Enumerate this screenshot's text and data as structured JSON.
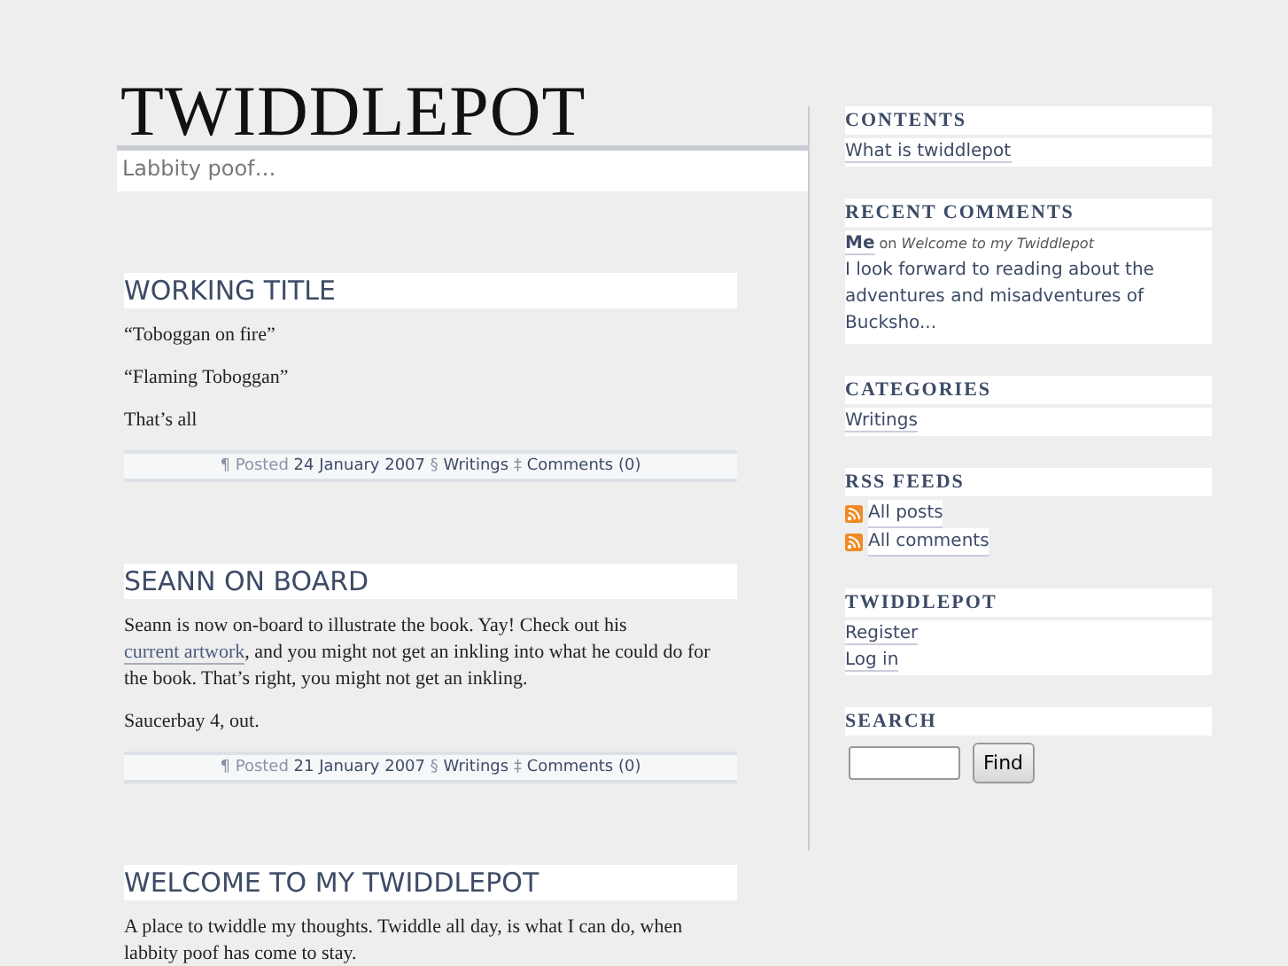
{
  "header": {
    "title": "TWIDDLEPOT",
    "tagline": "Labbity poof…"
  },
  "posts": [
    {
      "title": "WORKING TITLE",
      "paragraphs": [
        [
          {
            "text": "“Toboggan on fire”"
          }
        ],
        [
          {
            "text": "“Flaming Toboggan”"
          }
        ],
        [
          {
            "text": "That’s all"
          }
        ]
      ],
      "meta": {
        "posted": "¶ Posted",
        "date": "24 January 2007",
        "sep1": "§",
        "category": "Writings",
        "sep2": "‡",
        "comments": "Comments (0)"
      }
    },
    {
      "title": "SEANN ON BOARD",
      "paragraphs": [
        [
          {
            "text": "Seann is now on-board to illustrate the book. Yay! Check out his "
          },
          {
            "link": "current artwork"
          },
          {
            "text": ", and you might not get an inkling into what he could do for the book. That’s right, you might not get an inkling."
          }
        ],
        [
          {
            "text": "Saucerbay 4, out."
          }
        ]
      ],
      "meta": {
        "posted": "¶ Posted",
        "date": "21 January 2007",
        "sep1": "§",
        "category": "Writings",
        "sep2": "‡",
        "comments": "Comments (0)"
      }
    },
    {
      "title": "WELCOME TO MY TWIDDLEPOT",
      "paragraphs": [
        [
          {
            "text": "A place to twiddle my thoughts. Twiddle all day, is what I can do, when labbity poof has come to stay."
          }
        ]
      ]
    }
  ],
  "sidebar": [
    {
      "kind": "links",
      "title": "CONTENTS",
      "items": [
        "What is twiddlepot"
      ]
    },
    {
      "kind": "comments",
      "title": "RECENT COMMENTS",
      "author": "Me",
      "on": "on",
      "post": "Welcome to my Twiddlepot",
      "excerpt": "I look forward to reading about the adventures and misadventures of Bucksho..."
    },
    {
      "kind": "links",
      "title": "CATEGORIES",
      "items": [
        "Writings"
      ]
    },
    {
      "kind": "feeds",
      "title": "RSS FEEDS",
      "items": [
        "All posts",
        "All comments"
      ]
    },
    {
      "kind": "links",
      "title": "TWIDDLEPOT",
      "items": [
        "Register",
        "Log in"
      ]
    },
    {
      "kind": "search",
      "title": "SEARCH",
      "button": "Find"
    }
  ]
}
